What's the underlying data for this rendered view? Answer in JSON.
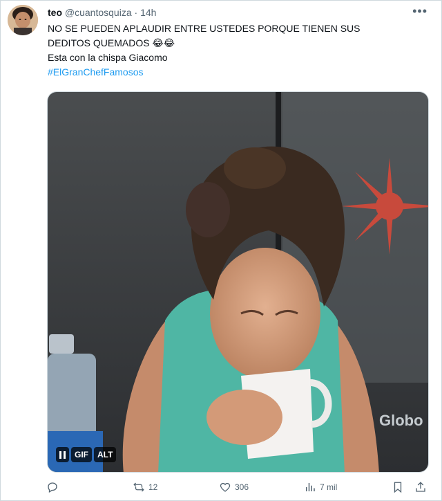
{
  "tweet": {
    "display_name": "teo",
    "handle": "@cuantosquiza",
    "separator": "·",
    "time": "14h",
    "more_icon": "more-horizontal-icon",
    "lines": [
      "NO SE PUEDEN APLAUDIR ENTRE USTEDES PORQUE TIENEN SUS",
      "DEDITOS QUEMADOS 😂😂",
      "Esta con la chispa Giacomo"
    ],
    "hashtag": "#ElGranChefFamosos"
  },
  "media": {
    "type": "gif",
    "watermark": "Globo",
    "badges": {
      "pause_icon": "pause-icon",
      "gif_label": "GIF",
      "alt_label": "ALT"
    }
  },
  "actions": {
    "reply": {
      "icon": "reply-icon",
      "count": ""
    },
    "retweet": {
      "icon": "retweet-icon",
      "count": "12"
    },
    "like": {
      "icon": "heart-icon",
      "count": "306"
    },
    "views": {
      "icon": "views-icon",
      "count": "7 mil"
    },
    "bookmark": {
      "icon": "bookmark-icon"
    },
    "share": {
      "icon": "share-icon"
    }
  },
  "colors": {
    "accent": "#1d9bf0",
    "secondary_text": "#536471",
    "primary_text": "#0f1419",
    "border": "#cfd9de"
  }
}
